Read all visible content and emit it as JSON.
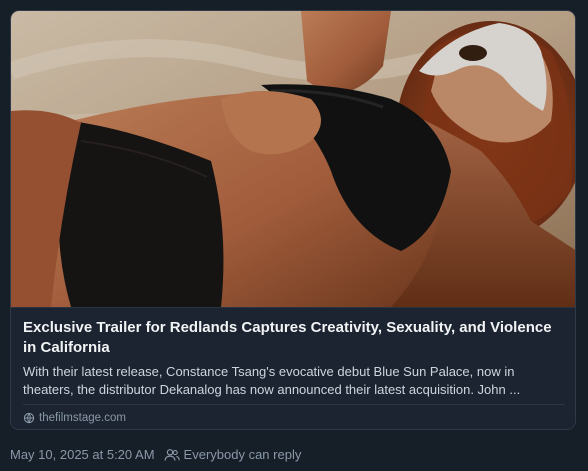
{
  "card": {
    "title": "Exclusive Trailer for Redlands Captures Creativity, Sexuality, and Violence in California",
    "description": "With their latest release, Constance Tsang's evocative debut Blue Sun Palace, now in theaters, the distributor Dekanalog has now announced their latest acquisition. John ...",
    "source": "thefilmstage.com",
    "thumbnail_icon": "photo-thumbnail"
  },
  "meta": {
    "timestamp": "May 10, 2025 at 5:20 AM",
    "reply_setting": "Everybody can reply",
    "reply_icon": "people-icon"
  },
  "colors": {
    "background": "#161e27",
    "card_border": "#2e3a48",
    "title_text": "#f1f3f5",
    "body_text": "#cdd5de",
    "muted_text": "#8b98a8"
  }
}
